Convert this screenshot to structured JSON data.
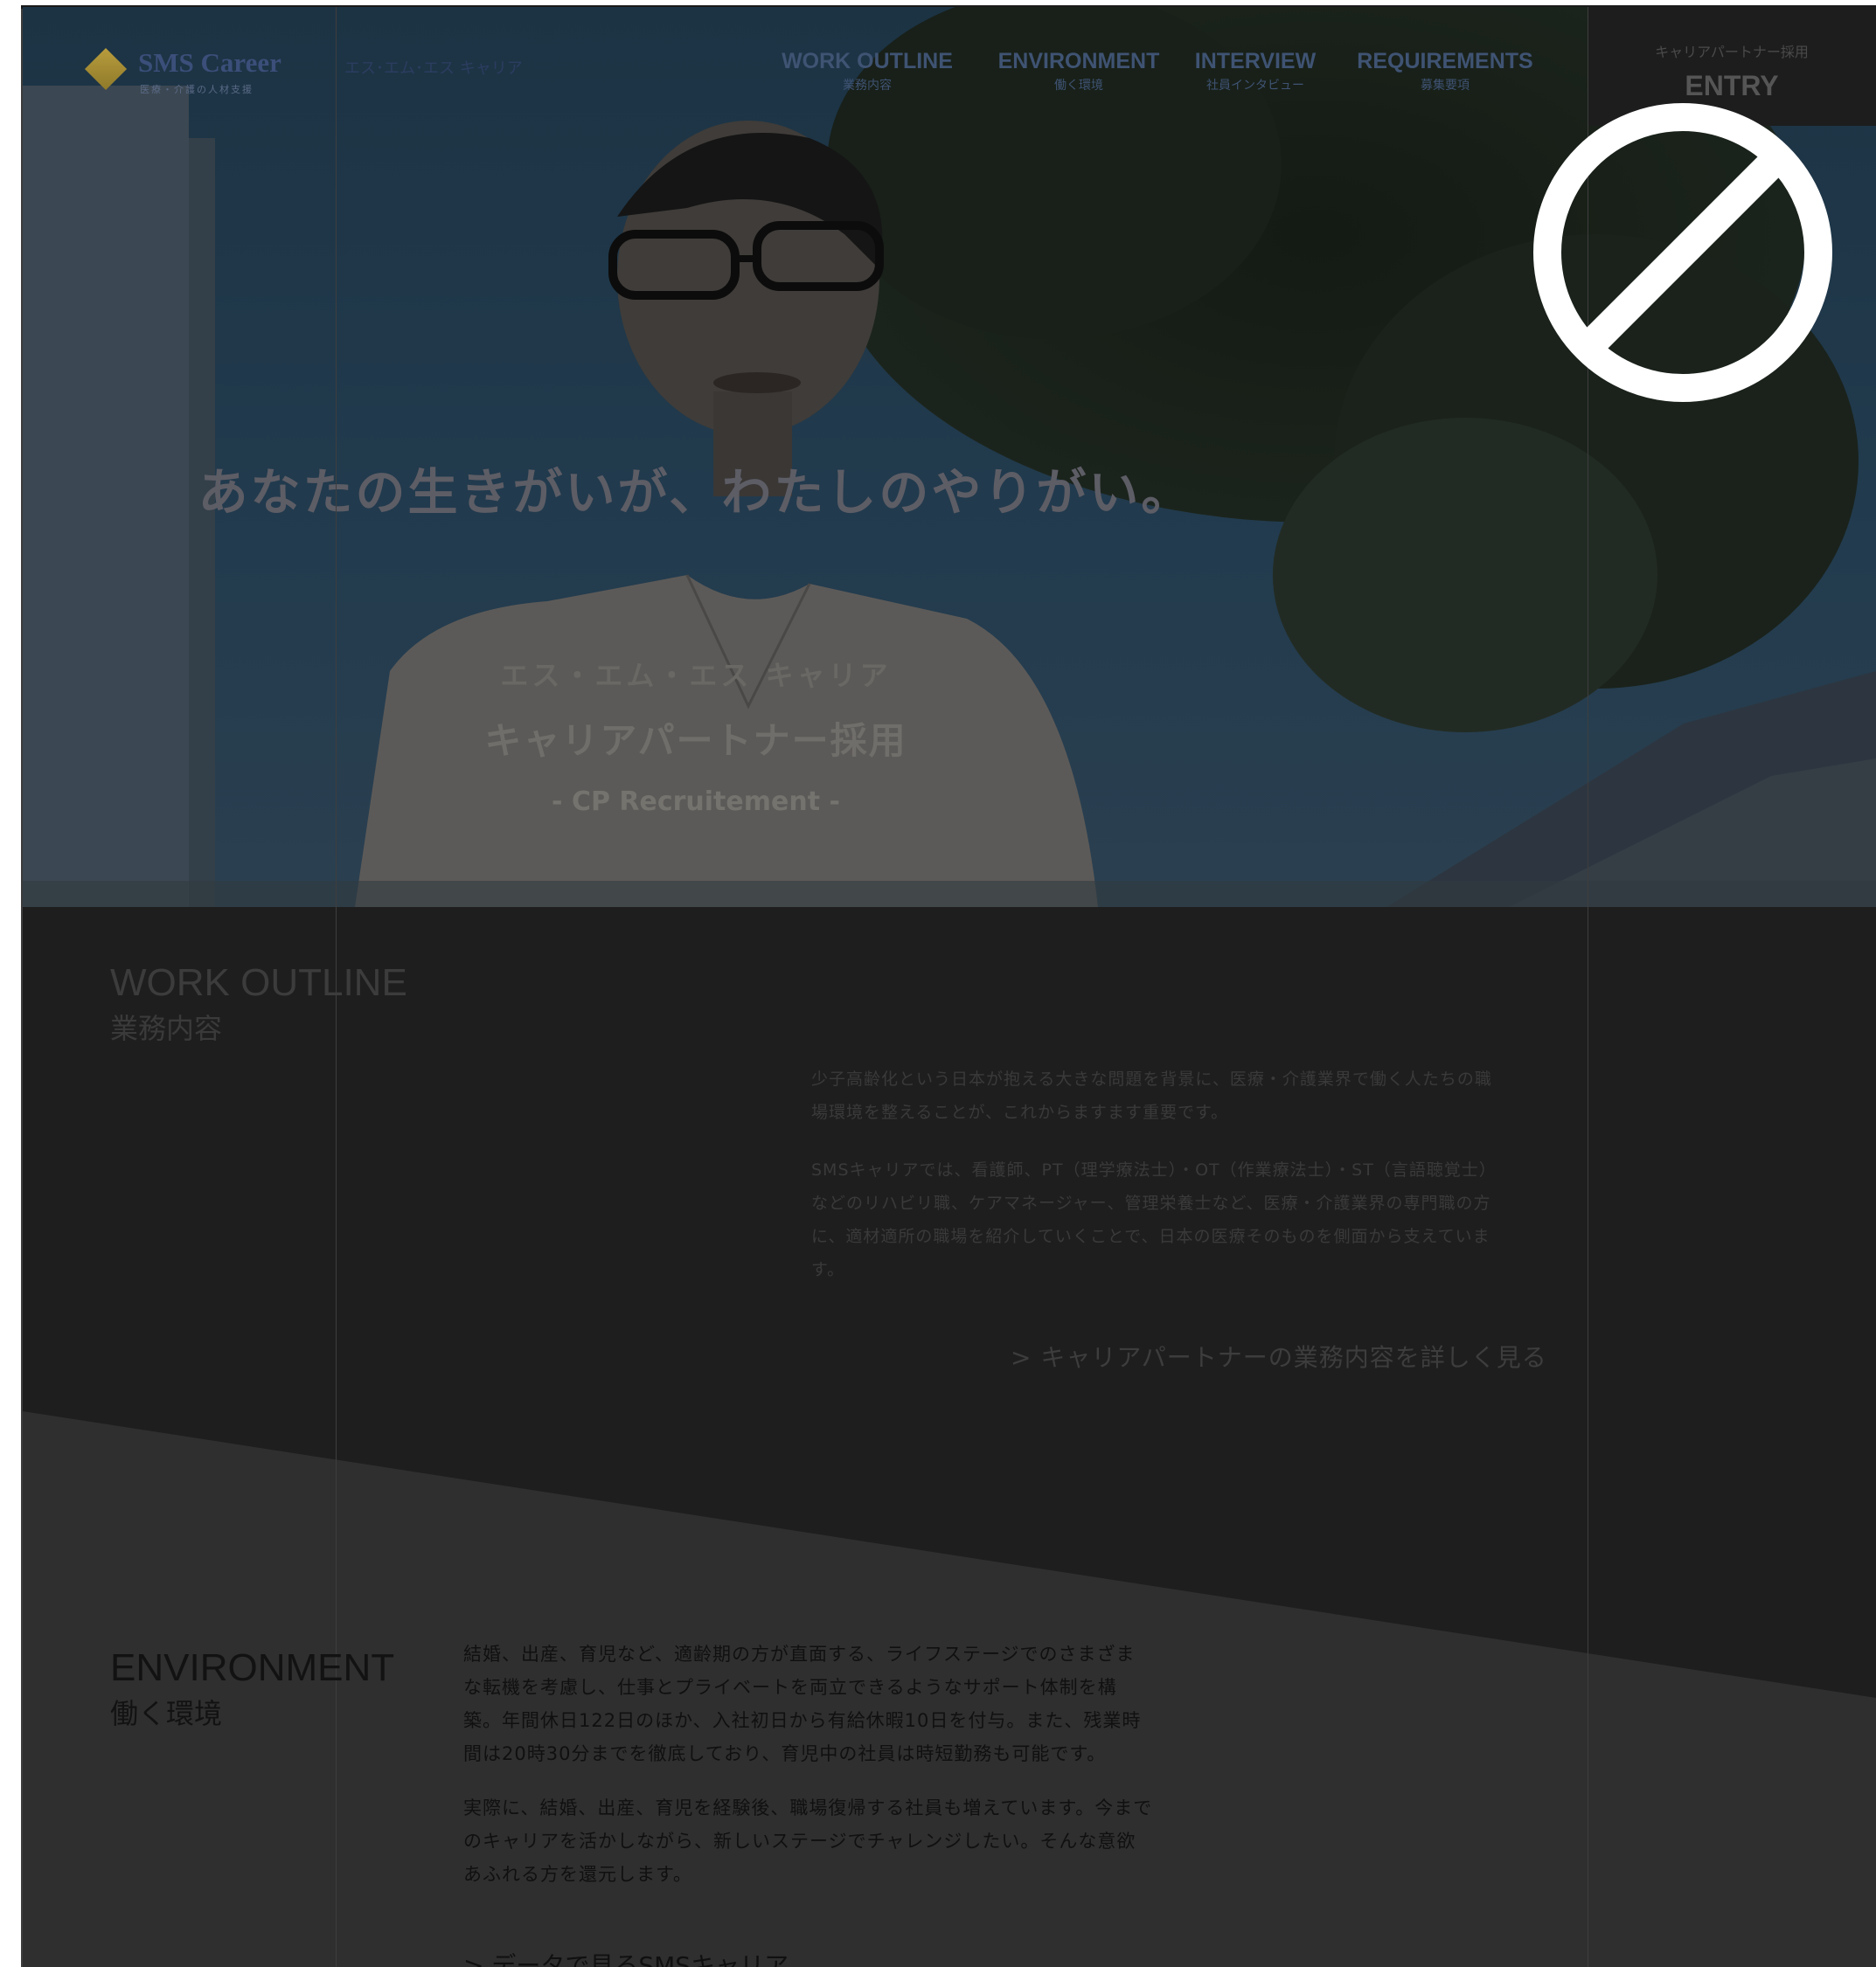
{
  "header": {
    "logo": {
      "name": "SMS Career",
      "kana": "エス･エム･エス キャリア",
      "tagline": "医療・介護の人材支援"
    },
    "nav": [
      {
        "en": "WORK OUTLINE",
        "ja": "業務内容"
      },
      {
        "en": "ENVIRONMENT",
        "ja": "働く環境"
      },
      {
        "en": "INTERVIEW",
        "ja": "社員インタビュー"
      },
      {
        "en": "REQUIREMENTS",
        "ja": "募集要項"
      }
    ],
    "entry": {
      "label": "キャリアパートナー採用",
      "button": "ENTRY"
    }
  },
  "overlay": {
    "icon": "no-entry-icon"
  },
  "hero": {
    "headline": "あなたの生きがいが、わたしのやりがい。",
    "company": "エス・エム・エス キャリア",
    "recruit": "キャリアパートナー採用",
    "subtitle": "- CP Recruitement -"
  },
  "work_outline": {
    "title_en": "WORK OUTLINE",
    "title_ja": "業務内容",
    "paragraphs": [
      "少子高齢化という日本が抱える大きな問題を背景に、医療・介護業界で働く人たちの職場環境を整えることが、これからますます重要です。",
      "SMSキャリアでは、看護師、PT（理学療法士）・OT（作業療法士）・ST（言語聴覚士）などのリハビリ職、ケアマネージャー、管理栄養士など、医療・介護業界の専門職の方に、適材適所の職場を紹介していくことで、日本の医療そのものを側面から支えています。"
    ],
    "link": "> キャリアパートナーの業務内容を詳しく見る"
  },
  "environment": {
    "title_en": "ENVIRONMENT",
    "title_ja": "働く環境",
    "paragraphs": [
      "結婚、出産、育児など、適齢期の方が直面する、ライフステージでのさまざまな転機を考慮し、仕事とプライベートを両立できるようなサポート体制を構築。年間休日122日のほか、入社初日から有給休暇10日を付与。また、残業時間は20時30分までを徹底しており、育児中の社員は時短勤務も可能です。",
      "実際に、結婚、出産、育児を経験後、職場復帰する社員も増えています。今までのキャリアを活かしながら、新しいステージでチャレンジしたい。そんな意欲あふれる方を還元します。"
    ],
    "link": "> データで見るSMSキャリア"
  },
  "colors": {
    "overlay_dim": "#000000",
    "work_bg": "#1e1e1e",
    "env_bg": "#2f2f2f",
    "entry_bg": "#1d1d1d",
    "logo_blue": "#3b4f7a",
    "logo_gold": "#b89c3d"
  }
}
